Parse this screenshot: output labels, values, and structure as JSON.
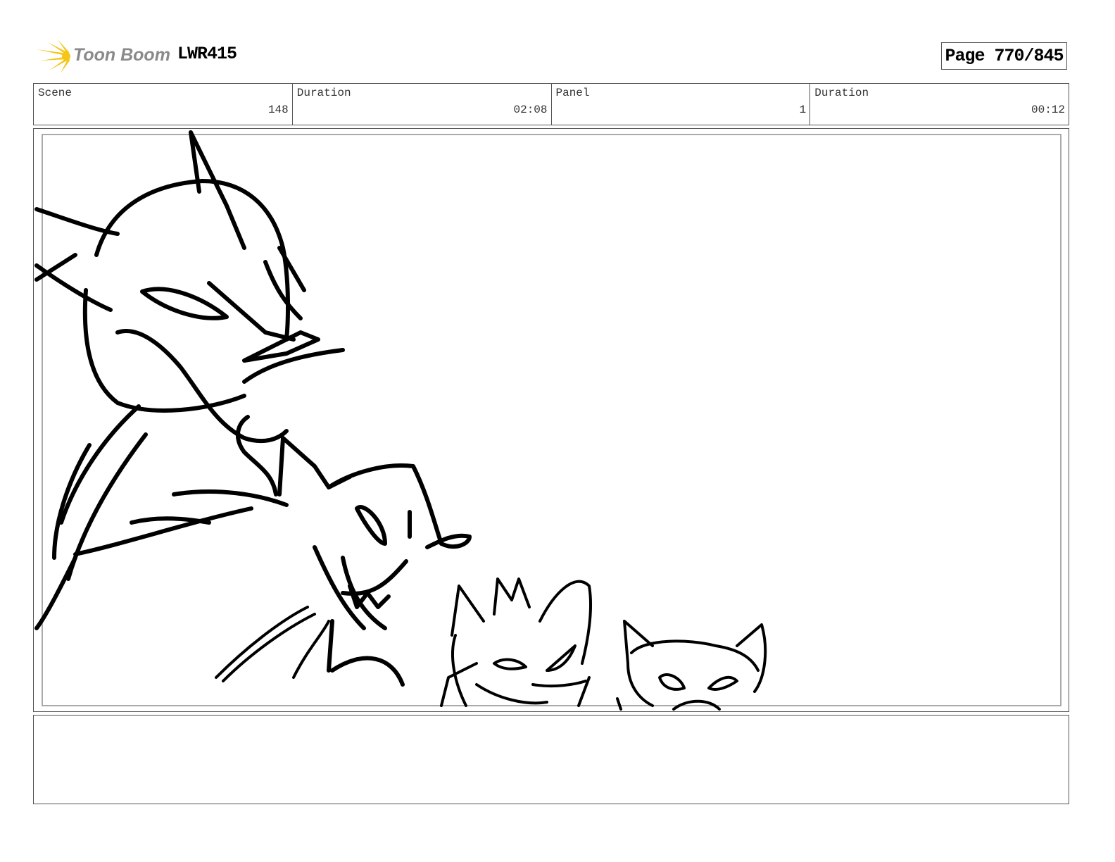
{
  "header": {
    "logo_text": "Toon Boom",
    "project": "LWR415",
    "page": "Page 770/845"
  },
  "info": [
    {
      "label": "Scene",
      "value": "148"
    },
    {
      "label": "Duration",
      "value": "02:08"
    },
    {
      "label": "Panel",
      "value": "1"
    },
    {
      "label": "Duration",
      "value": "00:12"
    }
  ],
  "colors": {
    "logo_burst": "#f5c518",
    "logo_text": "#8a8a8a"
  },
  "notes": ""
}
